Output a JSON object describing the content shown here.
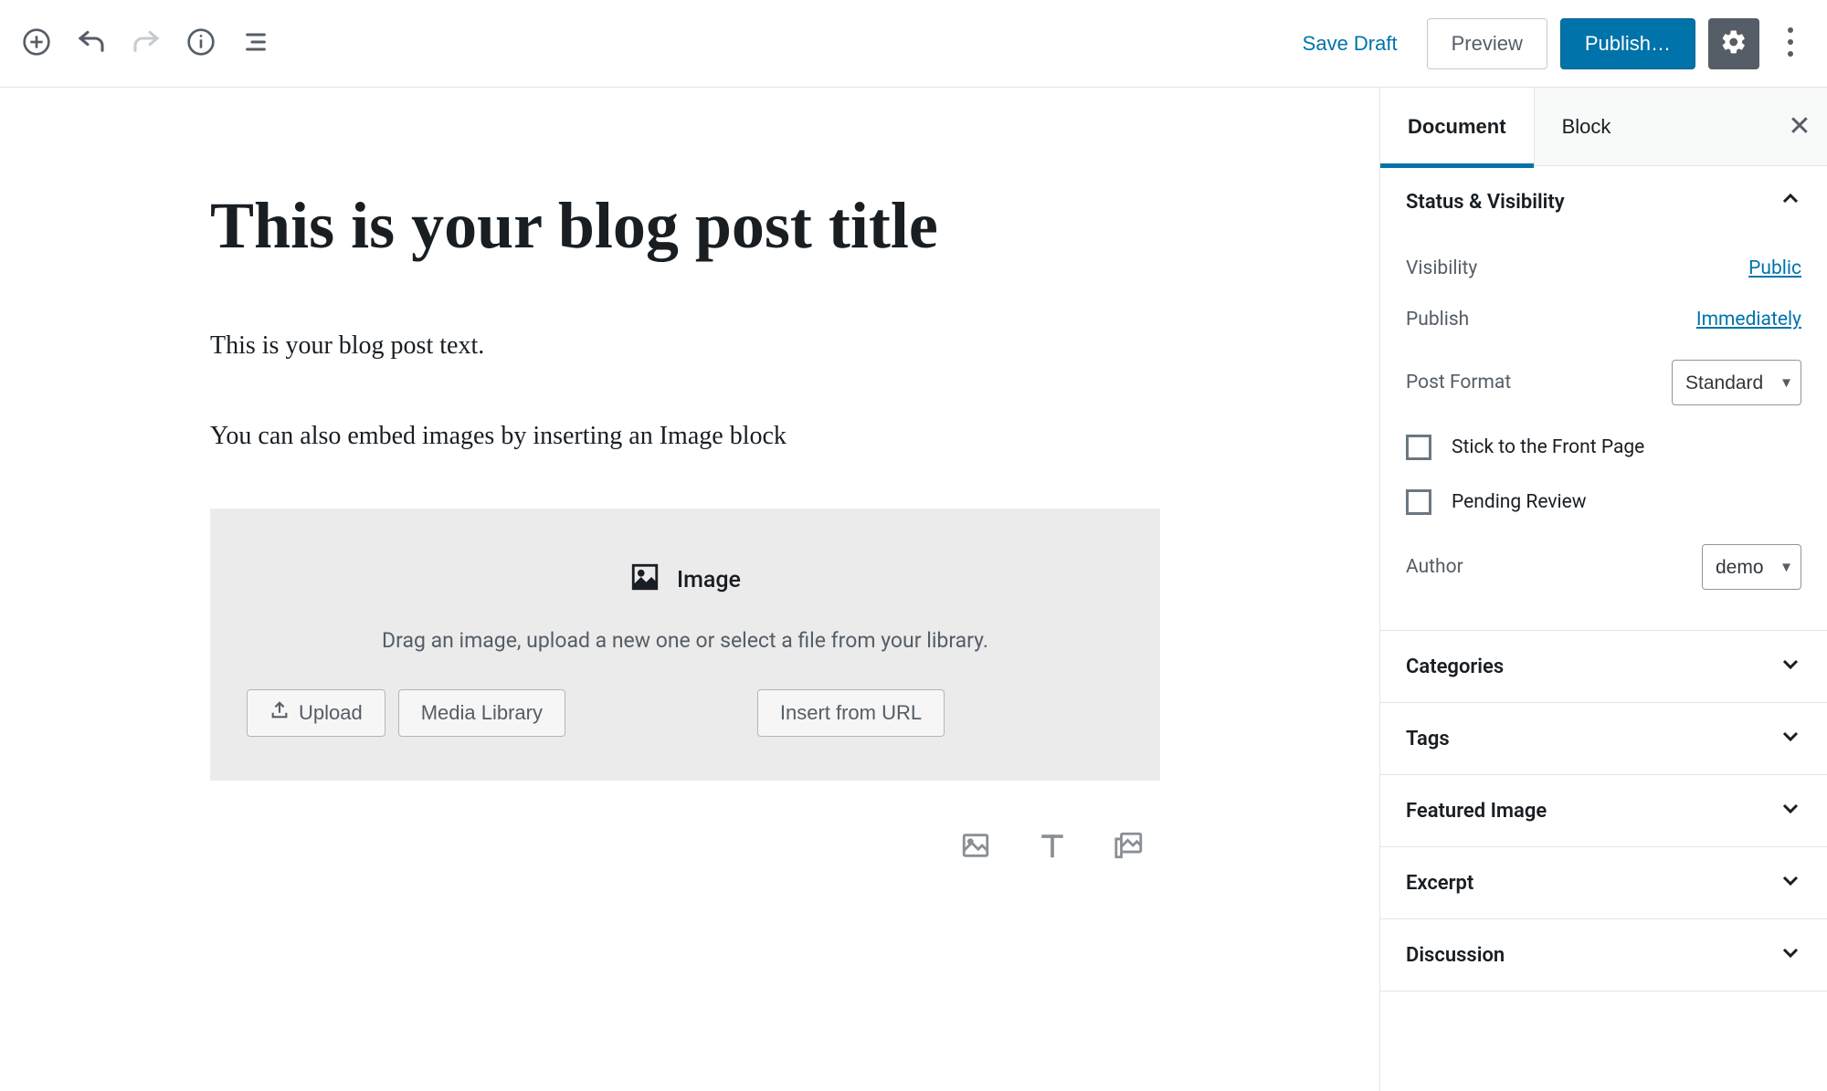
{
  "toolbar": {
    "save_draft": "Save Draft",
    "preview": "Preview",
    "publish": "Publish…"
  },
  "editor": {
    "title": "This is your blog post title",
    "para1": "This is your blog post text.",
    "para2": "You can also embed images by inserting an Image block",
    "image_block": {
      "label": "Image",
      "desc": "Drag an image, upload a new one or select a file from your library.",
      "upload": "Upload",
      "media_library": "Media Library",
      "insert_url": "Insert from URL"
    }
  },
  "sidebar": {
    "tabs": {
      "document": "Document",
      "block": "Block"
    },
    "status_visibility": {
      "heading": "Status & Visibility",
      "visibility_label": "Visibility",
      "visibility_value": "Public",
      "publish_label": "Publish",
      "publish_value": "Immediately",
      "post_format_label": "Post Format",
      "post_format_value": "Standard",
      "stick_front": "Stick to the Front Page",
      "pending_review": "Pending Review",
      "author_label": "Author",
      "author_value": "demo"
    },
    "panels": {
      "categories": "Categories",
      "tags": "Tags",
      "featured_image": "Featured Image",
      "excerpt": "Excerpt",
      "discussion": "Discussion"
    }
  }
}
